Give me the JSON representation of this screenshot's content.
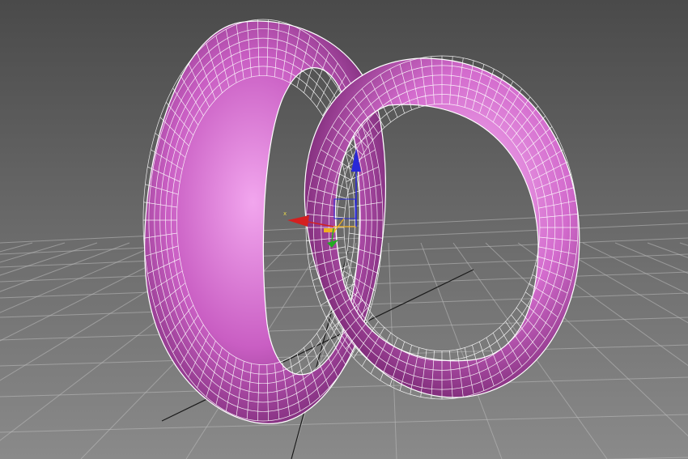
{
  "viewport": {
    "view": "perspective",
    "background_top": "#4a4a4a",
    "background_bottom": "#8a8a8a",
    "grid_color": "#bdbdbd",
    "home_grid_axis_color": "#1a1a1a"
  },
  "objects": [
    {
      "kind": "ring",
      "name": "large-ring",
      "selected": true,
      "fill": "#c95ec3",
      "wire": "#ffffff"
    },
    {
      "kind": "ring",
      "name": "small-ring",
      "selected": true,
      "fill": "#d36bcd",
      "wire": "#ffffff"
    }
  ],
  "gizmo": {
    "type": "move",
    "x_label": "x",
    "x_color": "#d42020",
    "y_color": "#22aa22",
    "z_color": "#2828d8",
    "plane_color": "#f0b020"
  }
}
